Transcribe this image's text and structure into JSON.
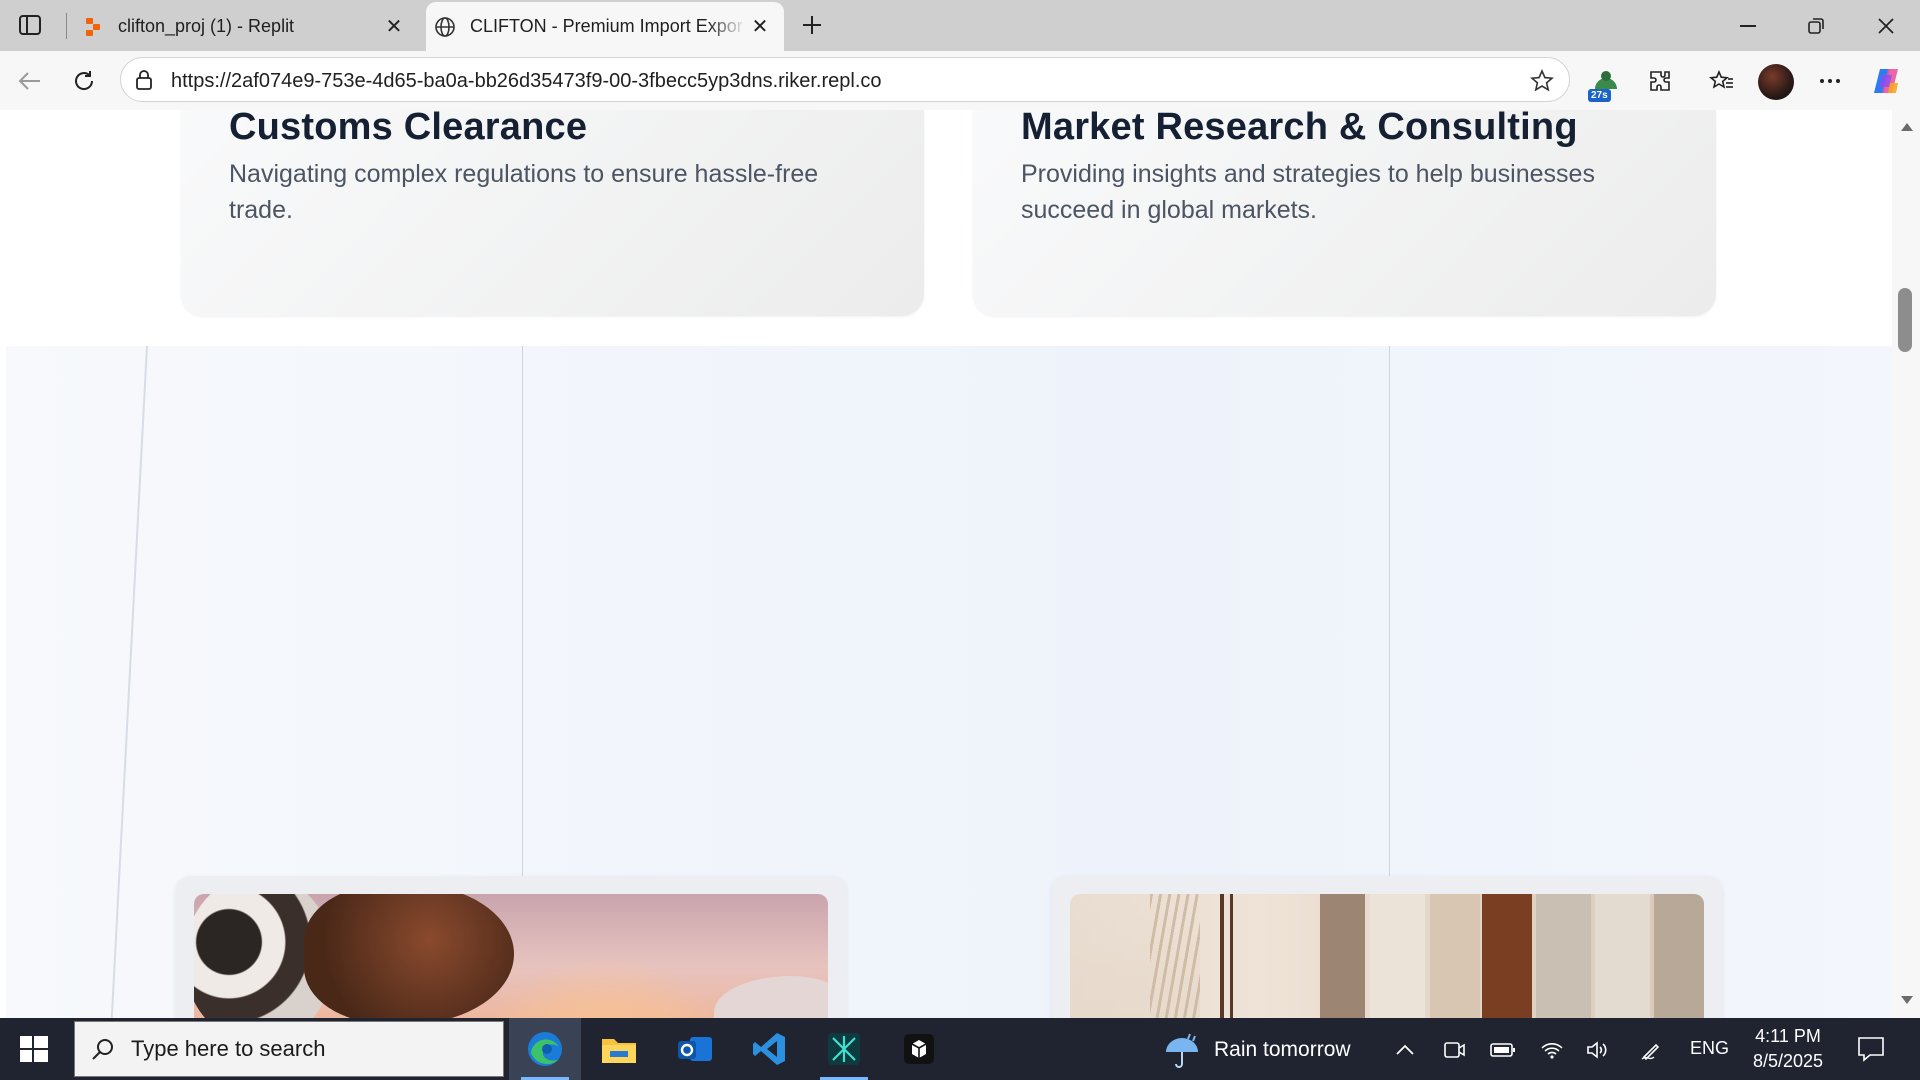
{
  "browser": {
    "tabs": [
      {
        "title": "clifton_proj (1) - Replit",
        "favicon": "replit-icon",
        "active": false
      },
      {
        "title": "CLIFTON - Premium Import Expor",
        "favicon": "globe-icon",
        "active": true
      }
    ],
    "url": "https://2af074e9-753e-4d65-ba0a-bb26d35473f9-00-3fbecc5yp3dns.riker.repl.co",
    "extension_badge": "27s"
  },
  "page": {
    "services": [
      {
        "title": "Customs Clearance",
        "description": "Navigating complex regulations to ensure hassle-free trade."
      },
      {
        "title": "Market Research & Consulting",
        "description": "Providing insights and strategies to help businesses succeed in global markets."
      }
    ],
    "product_images": [
      "cattle-photo",
      "clothing-rack-photo"
    ]
  },
  "taskbar": {
    "search_placeholder": "Type here to search",
    "weather": "Rain tomorrow",
    "language": "ENG",
    "time": "4:11 PM",
    "date": "8/5/2025",
    "apps": [
      "edge-icon",
      "file-explorer-icon",
      "outlook-icon",
      "vscode-icon",
      "app-icon",
      "app-icon-2"
    ]
  },
  "colors": {
    "heading": "#152033",
    "body_text": "#4b5563",
    "taskbar_bg": "#1f2430",
    "tab_bar_bg": "#cfcfcf"
  }
}
